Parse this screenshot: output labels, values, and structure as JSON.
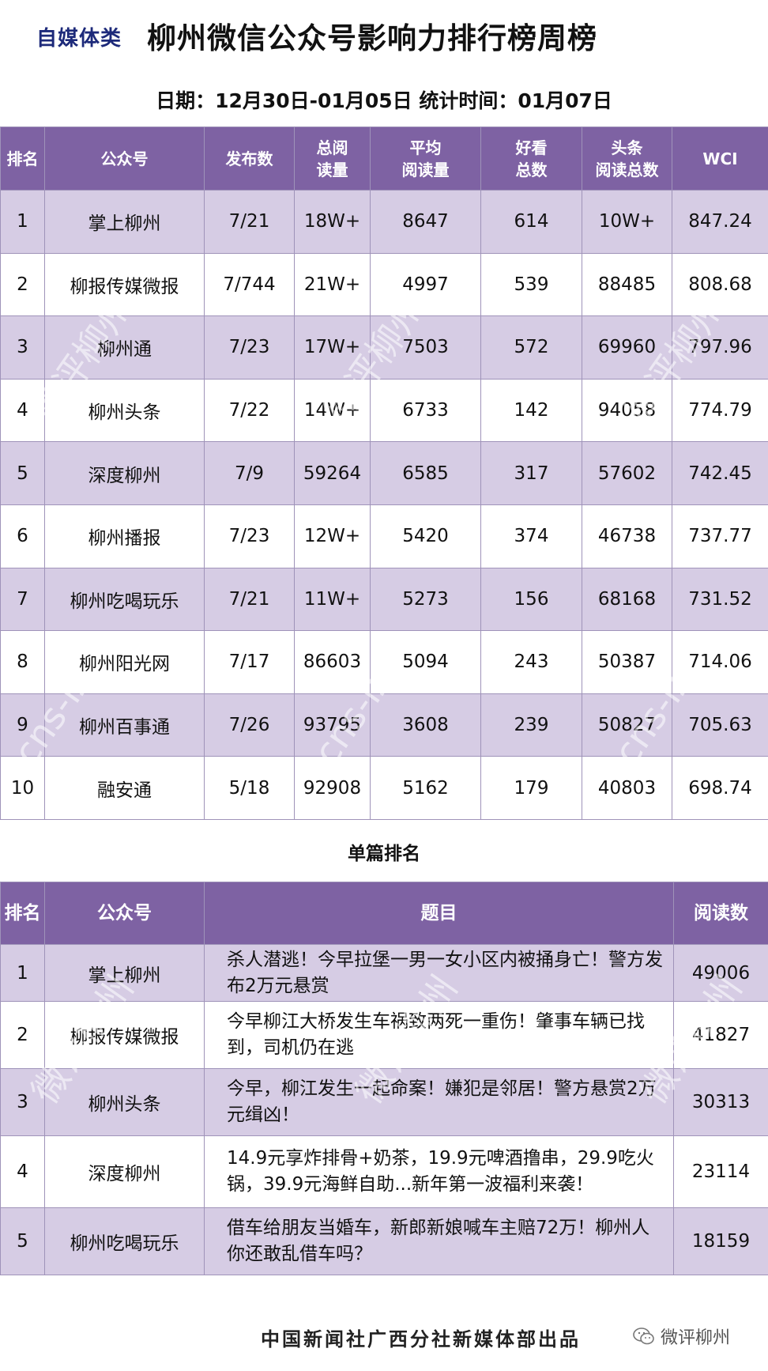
{
  "header": {
    "category": "自媒体类",
    "title": "柳州微信公众号影响力排行榜周榜",
    "dates": "日期：12月30日-01月05日  统计时间：01月07日"
  },
  "main_table": {
    "headers": [
      "排名",
      "公众号",
      "发布数",
      "总阅\n读量",
      "平均\n阅读量",
      "好看\n总数",
      "头条\n阅读总数",
      "WCI"
    ],
    "rows": [
      [
        "1",
        "掌上柳州",
        "7/21",
        "18W+",
        "8647",
        "614",
        "10W+",
        "847.24"
      ],
      [
        "2",
        "柳报传媒微报",
        "7/744",
        "21W+",
        "4997",
        "539",
        "88485",
        "808.68"
      ],
      [
        "3",
        "柳州通",
        "7/23",
        "17W+",
        "7503",
        "572",
        "69960",
        "797.96"
      ],
      [
        "4",
        "柳州头条",
        "7/22",
        "14W+",
        "6733",
        "142",
        "94058",
        "774.79"
      ],
      [
        "5",
        "深度柳州",
        "7/9",
        "59264",
        "6585",
        "317",
        "57602",
        "742.45"
      ],
      [
        "6",
        "柳州播报",
        "7/23",
        "12W+",
        "5420",
        "374",
        "46738",
        "737.77"
      ],
      [
        "7",
        "柳州吃喝玩乐",
        "7/21",
        "11W+",
        "5273",
        "156",
        "68168",
        "731.52"
      ],
      [
        "8",
        "柳州阳光网",
        "7/17",
        "86603",
        "5094",
        "243",
        "50387",
        "714.06"
      ],
      [
        "9",
        "柳州百事通",
        "7/26",
        "93795",
        "3608",
        "239",
        "50827",
        "705.63"
      ],
      [
        "10",
        "融安通",
        "5/18",
        "92908",
        "5162",
        "179",
        "40803",
        "698.74"
      ]
    ]
  },
  "single_section": {
    "title": "单篇排名",
    "headers": [
      "排名",
      "公众号",
      "题目",
      "阅读数"
    ],
    "rows": [
      [
        "1",
        "掌上柳州",
        "杀人潜逃！今早拉堡一男一女小区内被捅身亡！警方发布2万元悬赏",
        "49006"
      ],
      [
        "2",
        "柳报传媒微报",
        "今早柳江大桥发生车祸致两死一重伤！肇事车辆已找到，司机仍在逃",
        "41827"
      ],
      [
        "3",
        "柳州头条",
        "今早，柳江发生一起命案！嫌犯是邻居！警方悬赏2万元缉凶！",
        "30313"
      ],
      [
        "4",
        "深度柳州",
        "14.9元享炸排骨+奶茶，19.9元啤酒撸串，29.9吃火锅，39.9元海鲜自助...新年第一波福利来袭！",
        "23114"
      ],
      [
        "5",
        "柳州吃喝玩乐",
        "借车给朋友当婚车，新郎新娘喊车主赔72万！柳州人你还敢乱借车吗？",
        "18159"
      ]
    ]
  },
  "footer": {
    "credit": "中国新闻社广西分社新媒体部出品",
    "wechat_account": "微评柳州",
    "icon": "wechat-icon"
  },
  "watermark": {
    "text_a": "微评柳州",
    "text_b": "cns-lz"
  },
  "colors": {
    "header_purple": "#7e62a3",
    "row_lavender": "#d6cce4",
    "category_blue": "#1d2a7a"
  }
}
